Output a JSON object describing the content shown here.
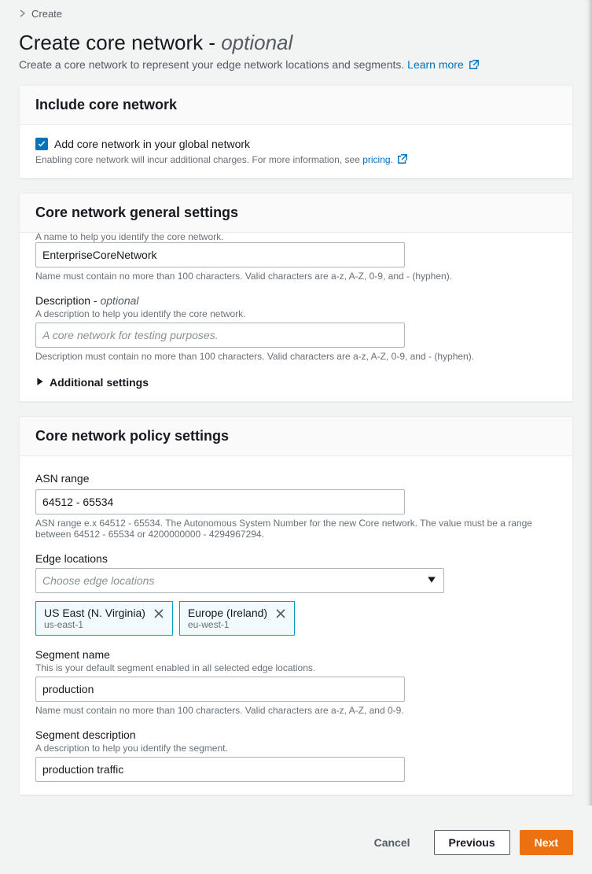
{
  "breadcrumb": {
    "current": "Create"
  },
  "header": {
    "title_prefix": "Create core network - ",
    "title_optional": "optional",
    "subtitle": "Create a core network to represent your edge network locations and segments. ",
    "learn_more": "Learn more"
  },
  "include_panel": {
    "title": "Include core network",
    "checkbox_label": "Add core network in your global network",
    "checkbox_checked": true,
    "helper_prefix": "Enabling core network will incur additional charges. For more information, see ",
    "helper_link": "pricing."
  },
  "general_panel": {
    "title": "Core network general settings",
    "name_helper_top": "A name to help you identify the core network.",
    "name_value": "EnterpriseCoreNetwork",
    "name_constraint": "Name must contain no more than 100 characters. Valid characters are a-z, A-Z, 0-9, and - (hyphen).",
    "desc_label": "Description - ",
    "desc_optional": "optional",
    "desc_helper": "A description to help you identify the core network.",
    "desc_placeholder": "A core network for testing purposes.",
    "desc_constraint": "Description must contain no more than 100 characters. Valid characters are a-z, A-Z, 0-9, and - (hyphen).",
    "additional": "Additional settings"
  },
  "policy_panel": {
    "title": "Core network policy settings",
    "asn_label": "ASN range",
    "asn_value": "64512 - 65534",
    "asn_helper": "ASN range e.x 64512 - 65534. The Autonomous System Number for the new Core network. The value must be a range between 64512 - 65534 or 4200000000 - 4294967294.",
    "edge_label": "Edge locations",
    "edge_placeholder": "Choose edge locations",
    "edge_tags": [
      {
        "name": "US East (N. Virginia)",
        "code": "us-east-1"
      },
      {
        "name": "Europe (Ireland)",
        "code": "eu-west-1"
      }
    ],
    "segment_name_label": "Segment name",
    "segment_name_helper": "This is your default segment enabled in all selected edge locations.",
    "segment_name_value": "production",
    "segment_name_constraint": "Name must contain no more than 100 characters. Valid characters are a-z, A-Z, and 0-9.",
    "segment_desc_label": "Segment description",
    "segment_desc_helper": "A description to help you identify the segment.",
    "segment_desc_value": "production traffic"
  },
  "footer": {
    "cancel": "Cancel",
    "previous": "Previous",
    "next": "Next"
  }
}
